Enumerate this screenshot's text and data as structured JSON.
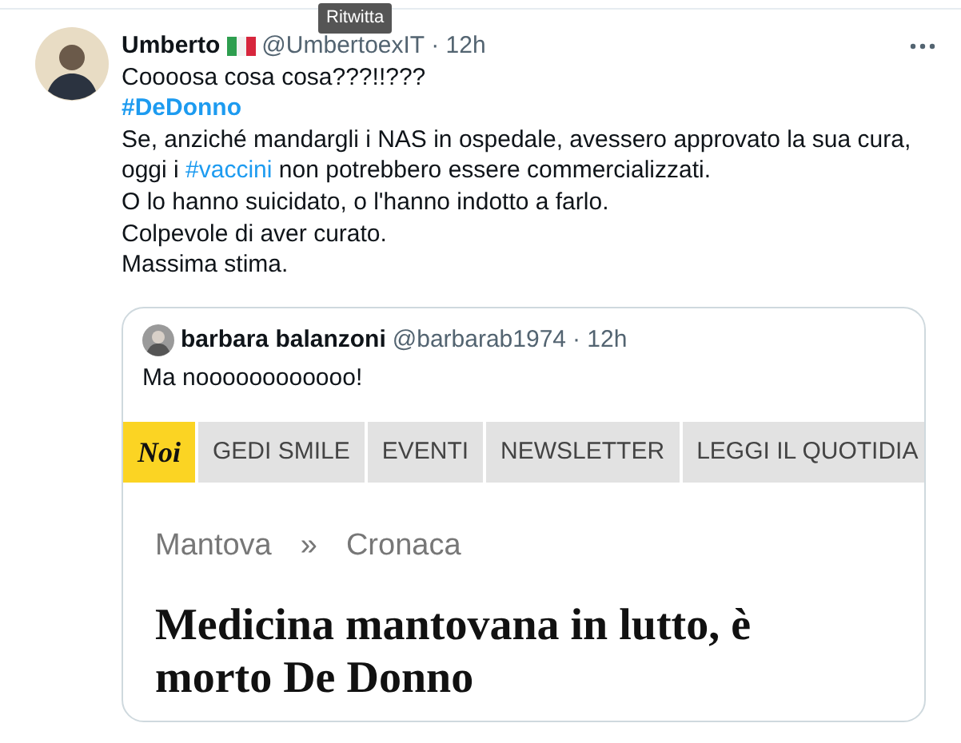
{
  "tooltip": {
    "text": "Ritwitta"
  },
  "tweet": {
    "author": "Umberto",
    "handle": "@UmbertoexIT",
    "time": "· 12h",
    "lines": [
      [
        {
          "text": "Coooosa cosa cosa???!!???",
          "kind": "plain"
        }
      ],
      [
        {
          "text": "#DeDonno",
          "kind": "hashtag",
          "bold": true
        }
      ],
      [
        {
          "text": "Se, anziché mandargli i NAS in ospedale, avessero approvato la sua cura,",
          "kind": "plain"
        }
      ],
      [
        {
          "text": "oggi i ",
          "kind": "plain"
        },
        {
          "text": "#vaccini",
          "kind": "hashtag",
          "bold": false
        },
        {
          "text": " non potrebbero essere commercializzati.",
          "kind": "plain"
        }
      ],
      [
        {
          "text": "O lo hanno suicidato, o l'hanno indotto a farlo.",
          "kind": "plain"
        }
      ],
      [
        {
          "text": "Colpevole di aver curato.",
          "kind": "plain"
        }
      ],
      [
        {
          "text": "Massima stima.",
          "kind": "plain"
        }
      ]
    ],
    "quote": {
      "author": "barbara balanzoni",
      "handle": "@barbarab1974",
      "time": "· 12h",
      "text": "Ma noooooooooooo!",
      "page": {
        "nav": [
          {
            "label": "Noi",
            "kind": "logo"
          },
          {
            "label": "GEDI SMILE",
            "kind": "link"
          },
          {
            "label": "EVENTI",
            "kind": "link"
          },
          {
            "label": "NEWSLETTER",
            "kind": "link"
          },
          {
            "label": "LEGGI IL QUOTIDIA",
            "kind": "link"
          }
        ],
        "breadcrumb": [
          "Mantova",
          "Cronaca"
        ],
        "separator": "»",
        "headline": "Medicina mantovana in lutto, è morto De Donno"
      }
    }
  }
}
